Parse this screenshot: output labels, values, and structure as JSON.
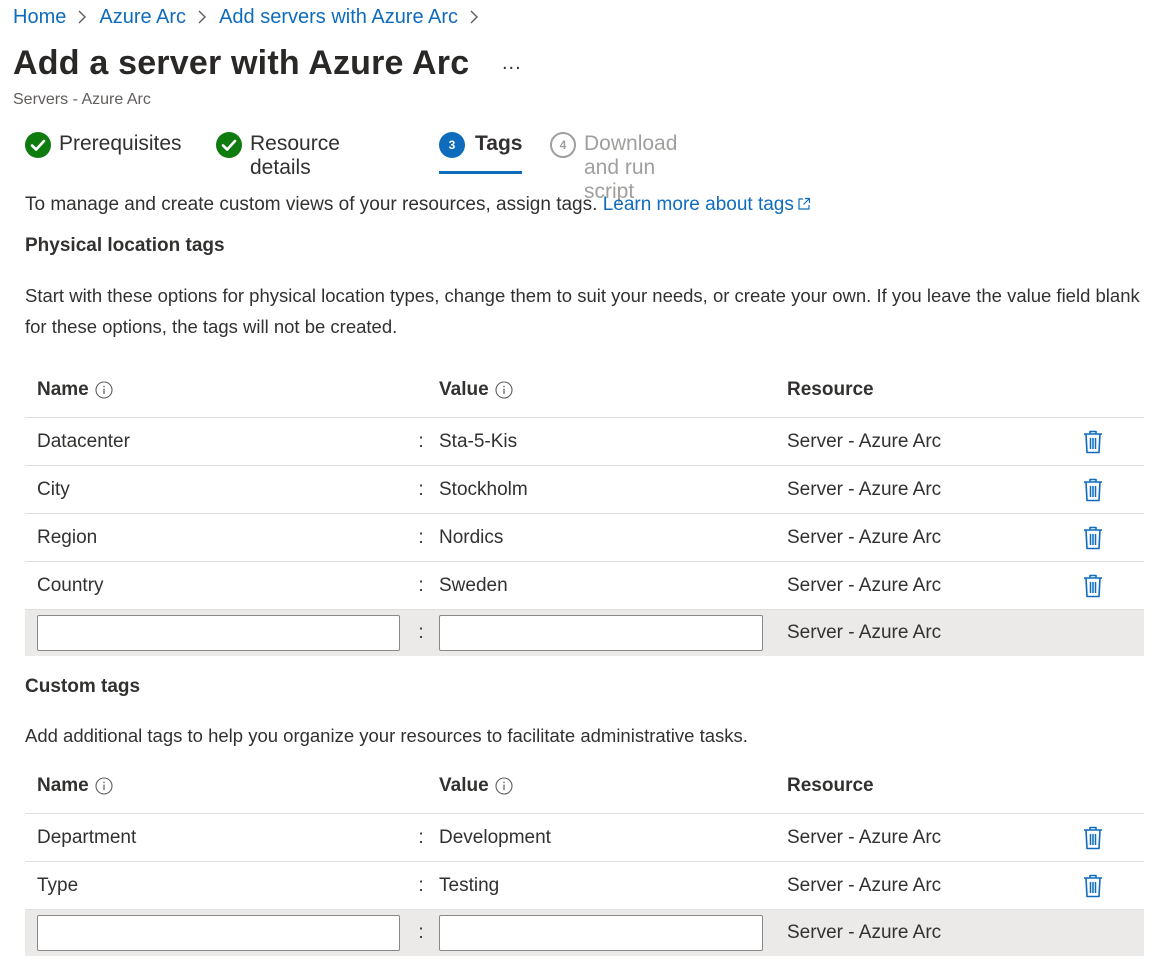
{
  "breadcrumb": [
    {
      "label": "Home"
    },
    {
      "label": "Azure Arc"
    },
    {
      "label": "Add servers with Azure Arc"
    }
  ],
  "page": {
    "title": "Add a server with Azure Arc",
    "more": "...",
    "subtitle": "Servers - Azure Arc"
  },
  "tabs": [
    {
      "label": "Prerequisites",
      "state": "done"
    },
    {
      "label": "Resource details",
      "state": "done"
    },
    {
      "label": "Tags",
      "number": "3",
      "state": "active"
    },
    {
      "label": "Download and run script",
      "number": "4",
      "state": "disabled"
    }
  ],
  "intro": {
    "text": "To manage and create custom views of your resources, assign tags.",
    "link": "Learn more about tags"
  },
  "physical": {
    "heading": "Physical location tags",
    "description": "Start with these options for physical location types, change them to suit your needs, or create your own. If you leave the value field blank for these options, the tags will not be created.",
    "rows": [
      {
        "name": "Datacenter",
        "value": "Sta-5-Kis",
        "resource": "Server - Azure Arc"
      },
      {
        "name": "City",
        "value": "Stockholm",
        "resource": "Server - Azure Arc"
      },
      {
        "name": "Region",
        "value": "Nordics",
        "resource": "Server - Azure Arc"
      },
      {
        "name": "Country",
        "value": "Sweden",
        "resource": "Server - Azure Arc"
      }
    ],
    "new_row": {
      "name": "",
      "value": "",
      "resource": "Server - Azure Arc"
    }
  },
  "custom": {
    "heading": "Custom tags",
    "description": "Add additional tags to help you organize your resources to facilitate administrative tasks.",
    "rows": [
      {
        "name": "Department",
        "value": "Development",
        "resource": "Server - Azure Arc"
      },
      {
        "name": "Type",
        "value": "Testing",
        "resource": "Server - Azure Arc"
      }
    ],
    "new_row": {
      "name": "",
      "value": "",
      "resource": "Server - Azure Arc"
    }
  },
  "columns": {
    "name": "Name",
    "value": "Value",
    "resource": "Resource",
    "separator": ":"
  },
  "colors": {
    "accent": "#0f6cbd",
    "success": "#107c10",
    "new_row_bg": "#ebeae9"
  },
  "icons": {
    "tab_done": "checkmark-circle-icon",
    "delete": "trash-icon",
    "info": "info-icon",
    "external": "external-link-icon"
  }
}
